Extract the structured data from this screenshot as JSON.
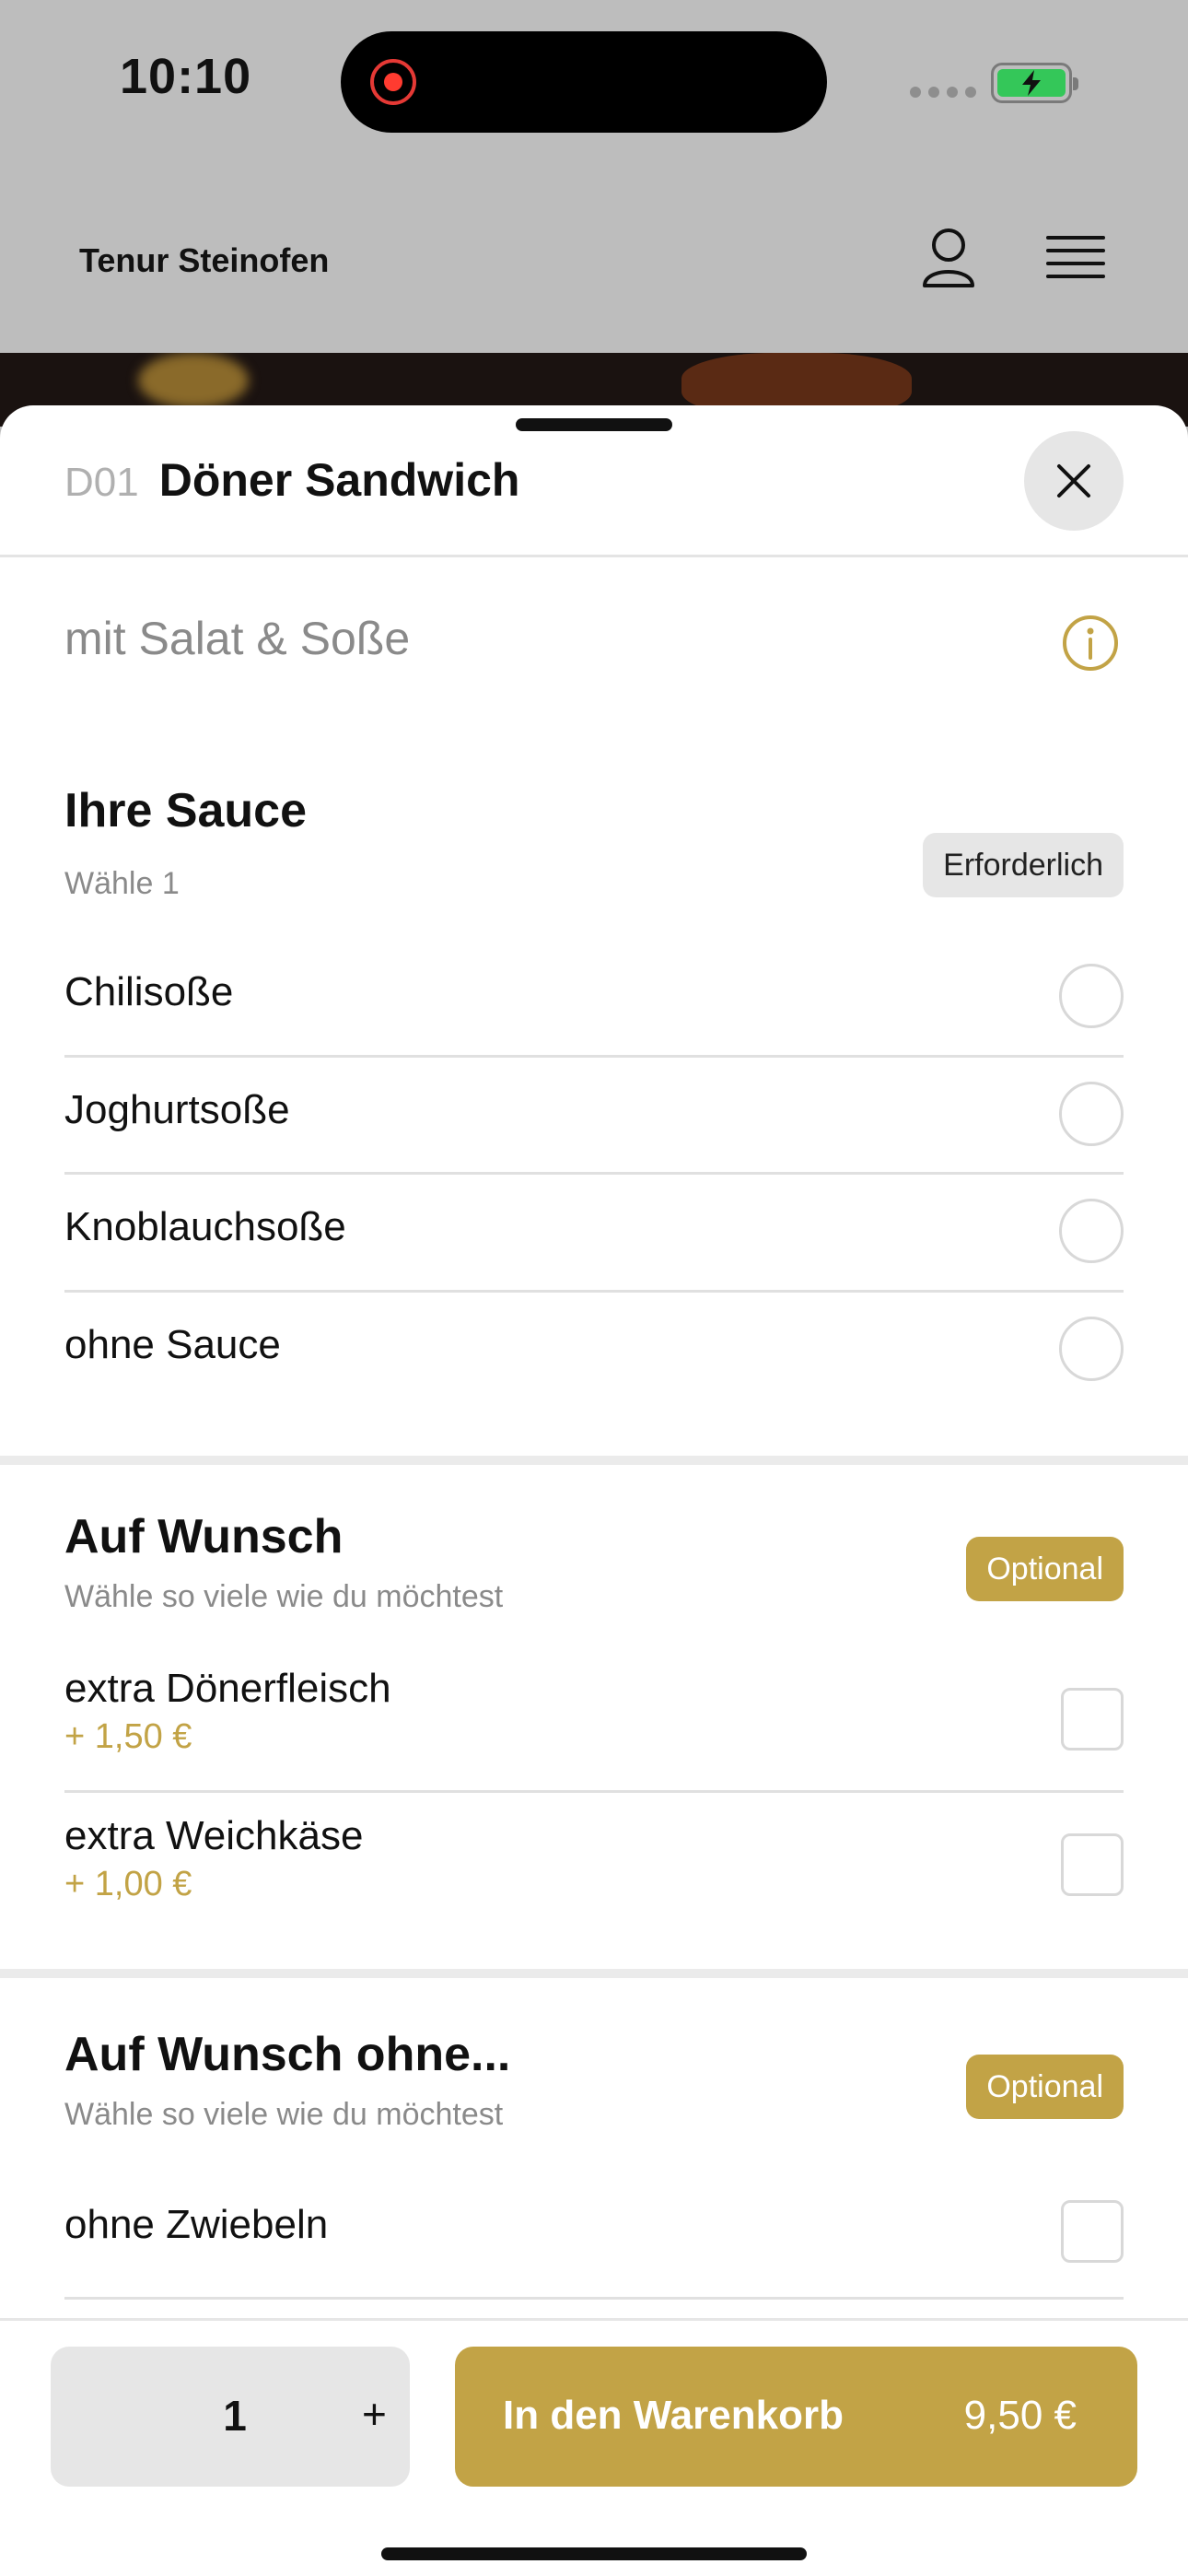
{
  "status_bar": {
    "time": "10:10"
  },
  "header": {
    "brand": "Tenur Steinofen"
  },
  "product": {
    "code": "D01",
    "name": "Döner Sandwich",
    "description": "mit Salat & Soße"
  },
  "sections": [
    {
      "title": "Ihre Sauce",
      "subtitle": "Wähle 1",
      "badge": "Erforderlich",
      "options": [
        {
          "label": "Chilisoße"
        },
        {
          "label": "Joghurtsoße"
        },
        {
          "label": "Knoblauchsoße"
        },
        {
          "label": "ohne Sauce"
        }
      ]
    },
    {
      "title": "Auf Wunsch",
      "subtitle": "Wähle so viele wie du möchtest",
      "badge": "Optional",
      "options": [
        {
          "label": "extra Dönerfleisch",
          "price": "+ 1,50 €"
        },
        {
          "label": "extra Weichkäse",
          "price": "+ 1,00 €"
        }
      ]
    },
    {
      "title": "Auf Wunsch ohne...",
      "subtitle": "Wähle so viele wie du möchtest",
      "badge": "Optional",
      "options": [
        {
          "label": "ohne Zwiebeln"
        }
      ]
    }
  ],
  "bottom_bar": {
    "quantity": "1",
    "plus": "+",
    "cart_label": "In den Warenkorb",
    "cart_price": "9,50 €"
  },
  "colors": {
    "accent": "#c2a346",
    "badge_grey": "#e6e6e6",
    "battery": "#34c759"
  }
}
